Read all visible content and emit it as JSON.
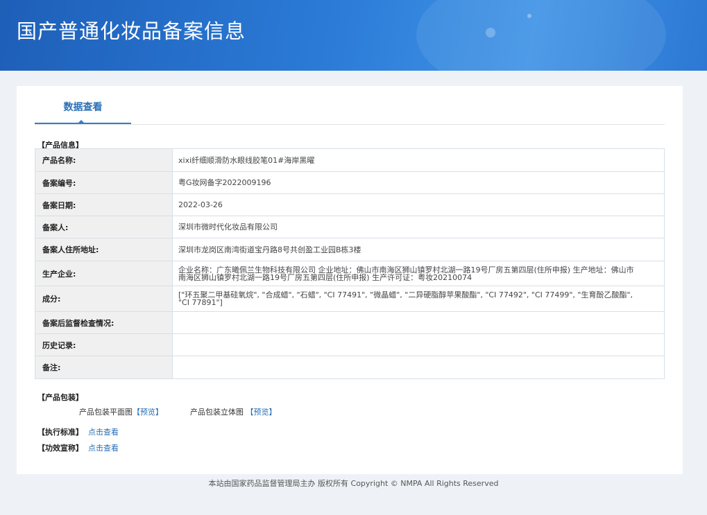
{
  "page_title": "国产普通化妆品备案信息",
  "tab_label": "数据查看",
  "product_info": {
    "section_label": "【产品信息】",
    "rows": [
      {
        "key": "产品名称:",
        "value": "xixi纤细顺滑防水眼线胶笔01#海岸黑曜"
      },
      {
        "key": "备案编号:",
        "value": "粤G妆网备字2022009196"
      },
      {
        "key": "备案日期:",
        "value": "2022-03-26"
      },
      {
        "key": "备案人:",
        "value": "深圳市微时代化妆品有限公司"
      },
      {
        "key": "备案人住所地址:",
        "value": "深圳市龙岗区南湾街道宝丹路8号共创盈工业园B栋3楼"
      },
      {
        "key": "生产企业:",
        "value": "企业名称：广东曦佩兰生物科技有限公司 企业地址：佛山市南海区狮山镇罗村北湖一路19号厂房五第四层(住所申报) 生产地址：佛山市南海区狮山镇罗村北湖一路19号厂房五第四层(住所申报) 生产许可证：粤妆20210074"
      },
      {
        "key": "成分:",
        "value": "[\"环五聚二甲基硅氧烷\", \"合成蜡\", \"石蜡\", \"CI 77491\", \"微晶蜡\", \"二异硬脂醇苹果酸酯\", \"CI 77492\", \"CI 77499\", \"生育酚乙酸酯\", \"CI 77891\"]"
      },
      {
        "key": "备案后监督检查情况:",
        "value": ""
      },
      {
        "key": "历史记录:",
        "value": ""
      },
      {
        "key": "备注:",
        "value": ""
      }
    ]
  },
  "packaging": {
    "section_label": "【产品包装】",
    "flat_label": "产品包装平面图",
    "flat_link": "【预览】",
    "stereo_label": "产品包装立体图",
    "stereo_link": "【预览】"
  },
  "standard": {
    "label": "【执行标准】",
    "link": "点击查看"
  },
  "efficacy": {
    "label": "【功效宣称】",
    "link": "点击查看"
  },
  "footer": "本站由国家药品监督管理局主办 版权所有 Copyright © NMPA All Rights Reserved"
}
